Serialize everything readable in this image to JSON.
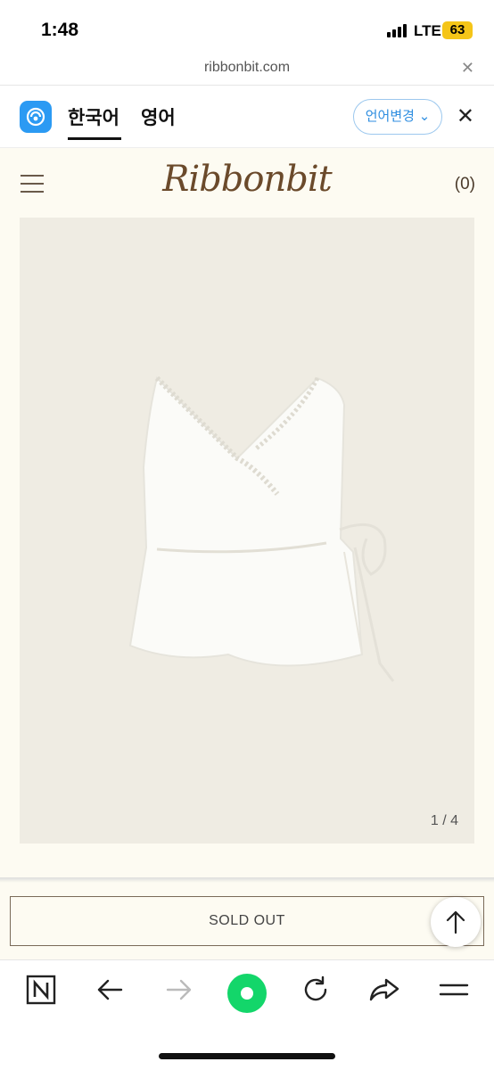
{
  "status_bar": {
    "time": "1:48",
    "network": "LTE",
    "battery": "63"
  },
  "url_bar": {
    "url": "ribbonbit.com",
    "close_label": "✕"
  },
  "translate_bar": {
    "source_lang": "한국어",
    "target_lang": "영어",
    "change_label": "언어변경",
    "close_label": "✕"
  },
  "site_header": {
    "brand": "Ribbonbit",
    "cart": "(0)"
  },
  "product": {
    "image_counter": "1 / 4"
  },
  "actions": {
    "sold_out_label": "SOLD OUT"
  },
  "colors": {
    "page_bg": "#fdfbf2",
    "image_bg": "#efece3",
    "brand_text": "#6b4a2b",
    "translate_accent": "#2b9af3",
    "browser_green": "#13d66a"
  },
  "icons": {
    "top_button": "arrow-up-icon",
    "bottom_bar": [
      "n-home-icon",
      "back-arrow-icon",
      "forward-arrow-icon",
      "green-dot-icon",
      "refresh-icon",
      "share-icon",
      "menu-icon"
    ]
  }
}
